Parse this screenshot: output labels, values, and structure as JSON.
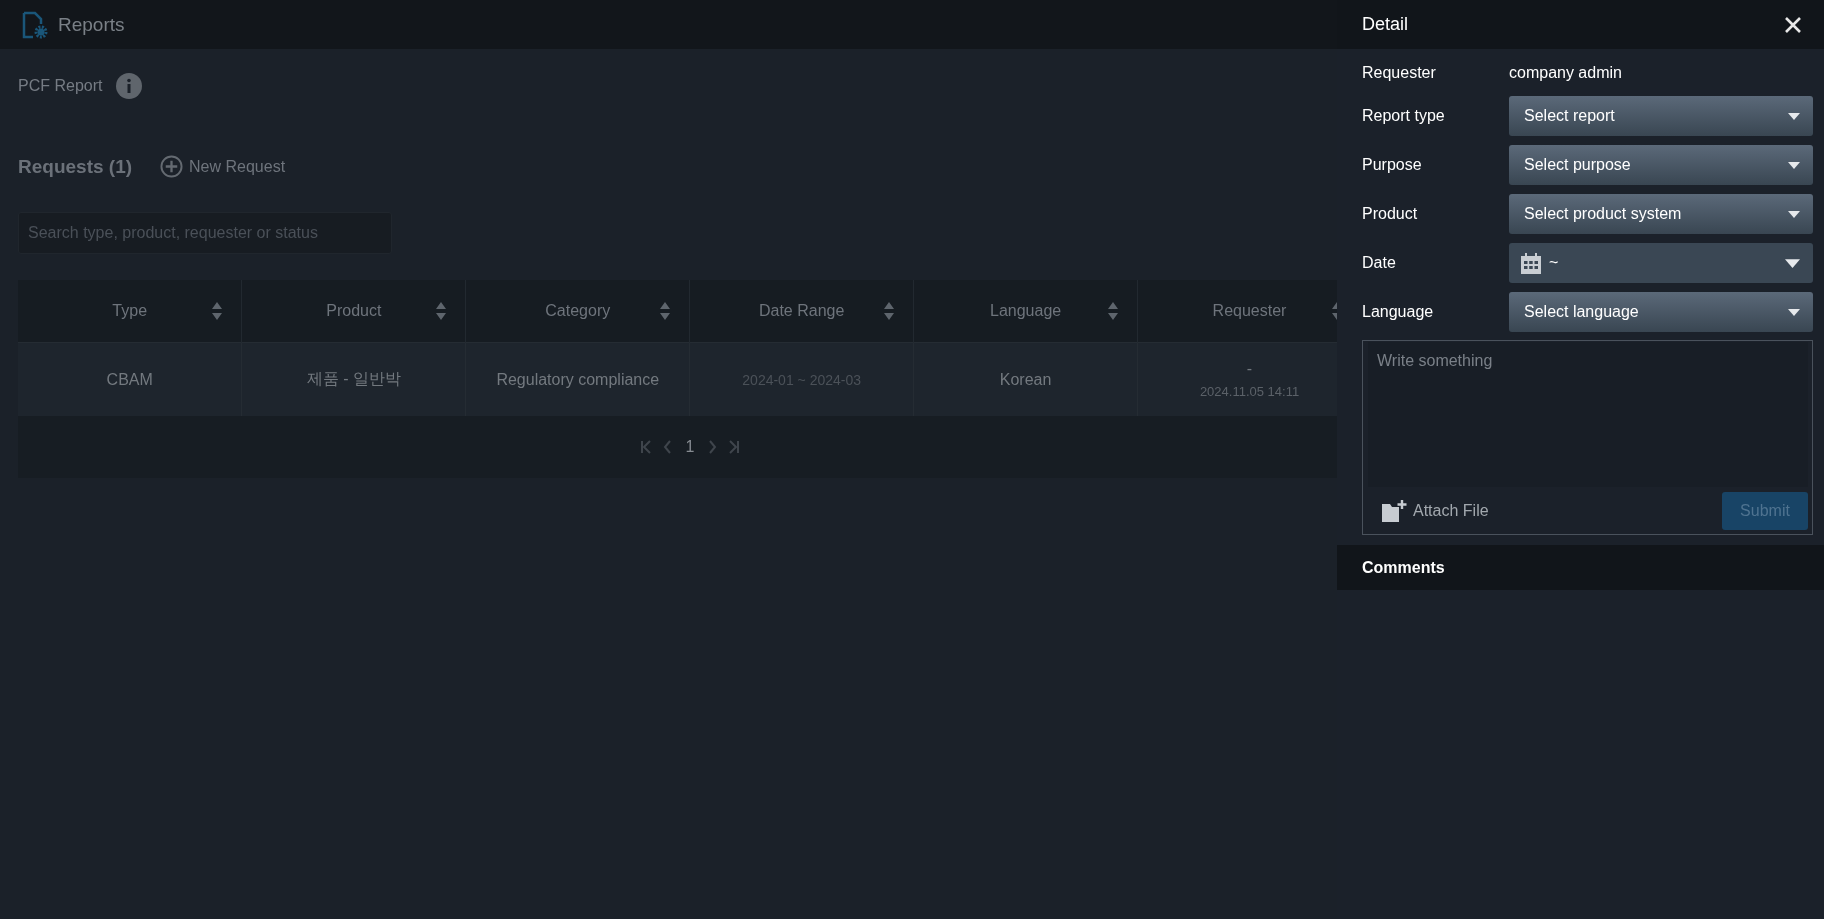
{
  "header": {
    "title": "Reports"
  },
  "page": {
    "title": "PCF Report"
  },
  "requests": {
    "heading": "Requests (1)",
    "new_button": "New Request"
  },
  "search": {
    "placeholder": "Search type, product, requester or status"
  },
  "table": {
    "columns": [
      "Type",
      "Product",
      "Category",
      "Date Range",
      "Language",
      "Requester"
    ],
    "rows": [
      {
        "cells": [
          {
            "text": "CBAM",
            "muted": false
          },
          {
            "text": "제품 - 일반박",
            "muted": false
          },
          {
            "text": "Regulatory compliance",
            "muted": false
          },
          {
            "text": "2024-01 ~ 2024-03",
            "muted": true
          },
          {
            "text": "Korean",
            "muted": false
          },
          {
            "text": "-",
            "subtext": "2024.11.05 14:11",
            "muted": false
          }
        ]
      }
    ]
  },
  "pagination": {
    "pages": [
      {
        "label": "1",
        "selected": true
      }
    ]
  },
  "detail": {
    "title": "Detail",
    "fields": [
      {
        "kind": "text",
        "label": "Requester",
        "value": "company admin"
      },
      {
        "kind": "select",
        "label": "Report type",
        "placeholder": "Select report"
      },
      {
        "kind": "select",
        "label": "Purpose",
        "placeholder": "Select purpose"
      },
      {
        "kind": "select",
        "label": "Product",
        "placeholder": "Select product system"
      },
      {
        "kind": "date",
        "label": "Date",
        "value": "~"
      },
      {
        "kind": "select",
        "label": "Language",
        "placeholder": "Select language"
      }
    ],
    "comment": {
      "placeholder": "Write something",
      "attach": "Attach File",
      "submit": "Submit",
      "submit_disabled": true
    },
    "comments_heading": "Comments"
  }
}
